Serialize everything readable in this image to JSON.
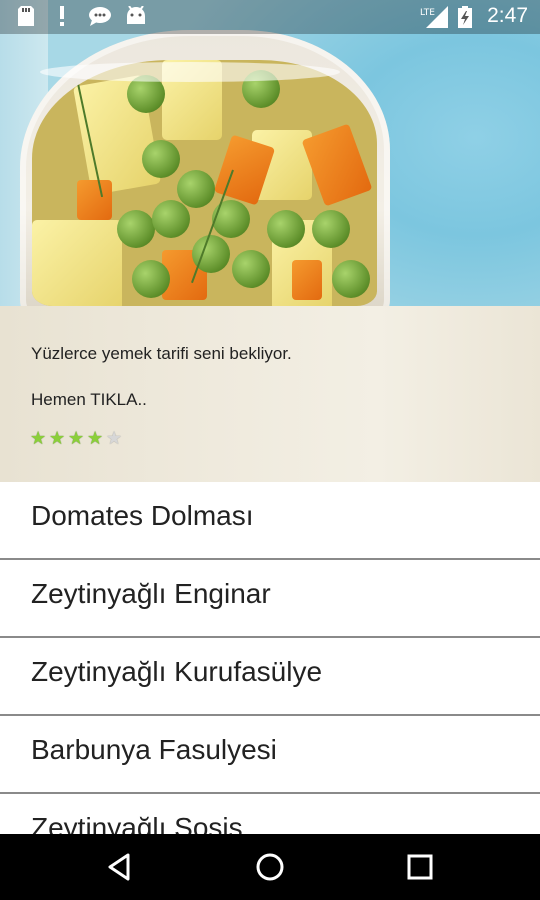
{
  "status_bar": {
    "time": "2:47",
    "network": "LTE",
    "icons": [
      "sd-card-icon",
      "alert-icon",
      "chat-icon",
      "android-icon",
      "signal-icon",
      "battery-charging-icon"
    ]
  },
  "promo": {
    "line1": "Yüzlerce yemek tarifi seni bekliyor.",
    "line2": "Hemen TIKLA..",
    "rating": 4,
    "rating_max": 5
  },
  "recipes": [
    {
      "label": "Domates Dolması"
    },
    {
      "label": "Zeytinyağlı Enginar"
    },
    {
      "label": "Zeytinyağlı Kurufasülye"
    },
    {
      "label": "Barbunya Fasulyesi"
    },
    {
      "label": "Zeytinyağlı Sosis"
    }
  ],
  "nav": {
    "back": "back-icon",
    "home": "home-icon",
    "recents": "recents-icon"
  },
  "colors": {
    "star_on": "#8bcf3a",
    "star_off": "#d7d7d7",
    "divider": "#8a8a8a"
  }
}
